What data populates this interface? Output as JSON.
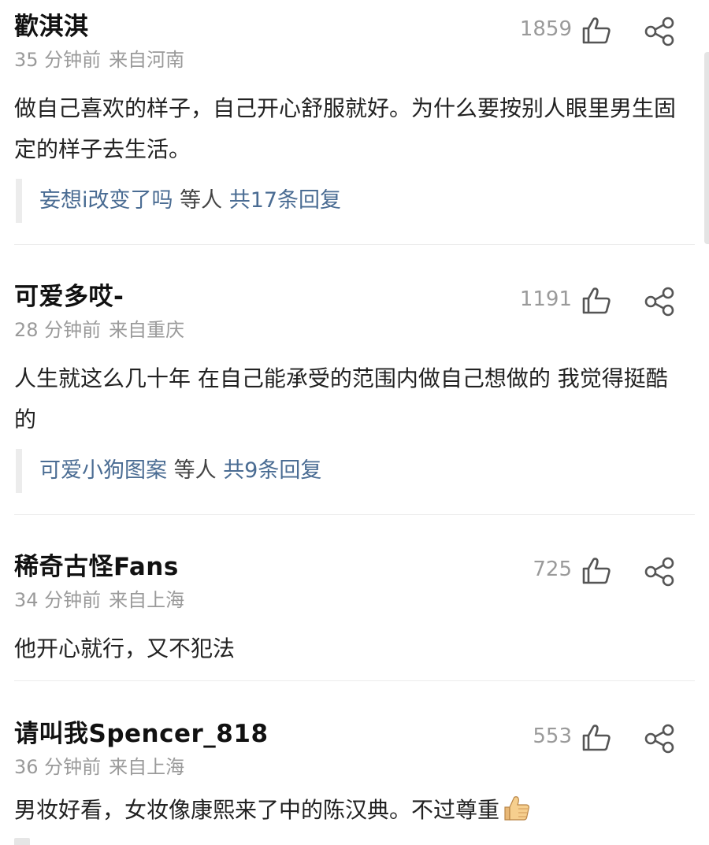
{
  "comments": [
    {
      "author": "歡淇淇",
      "time": "35 分钟前",
      "location": "来自河南",
      "likes": "1859",
      "content": "做自己喜欢的样子，自己开心舒服就好。为什么要按别人眼里男生固定的样子去生活。",
      "replies": {
        "names": "妄想i改变了吗",
        "middle": "等人",
        "total": "共17条回复"
      }
    },
    {
      "author": "可爱多哎-",
      "time": "28 分钟前",
      "location": "来自重庆",
      "likes": "1191",
      "content": "人生就这么几十年 在自己能承受的范围内做自己想做的 我觉得挺酷的",
      "replies": {
        "names": "可爱小狗图案",
        "middle": "等人",
        "total": "共9条回复"
      }
    },
    {
      "author": "稀奇古怪Fans",
      "time": "34 分钟前",
      "location": "来自上海",
      "likes": "725",
      "content": "他开心就行，又不犯法"
    },
    {
      "author": "请叫我Spencer_818",
      "time": "36 分钟前",
      "location": "来自上海",
      "likes": "553",
      "content": "男妆好看，女妆像康熙来了中的陈汉典。不过尊重"
    }
  ],
  "icons": {
    "like": "thumbs-up-outline-icon",
    "share": "share-icon",
    "emoji": "thumbs-up-emoji-icon"
  },
  "colors": {
    "author": "#111111",
    "meta": "#9a9a9a",
    "reply_link": "#4a6c93",
    "divider": "#ececec"
  }
}
